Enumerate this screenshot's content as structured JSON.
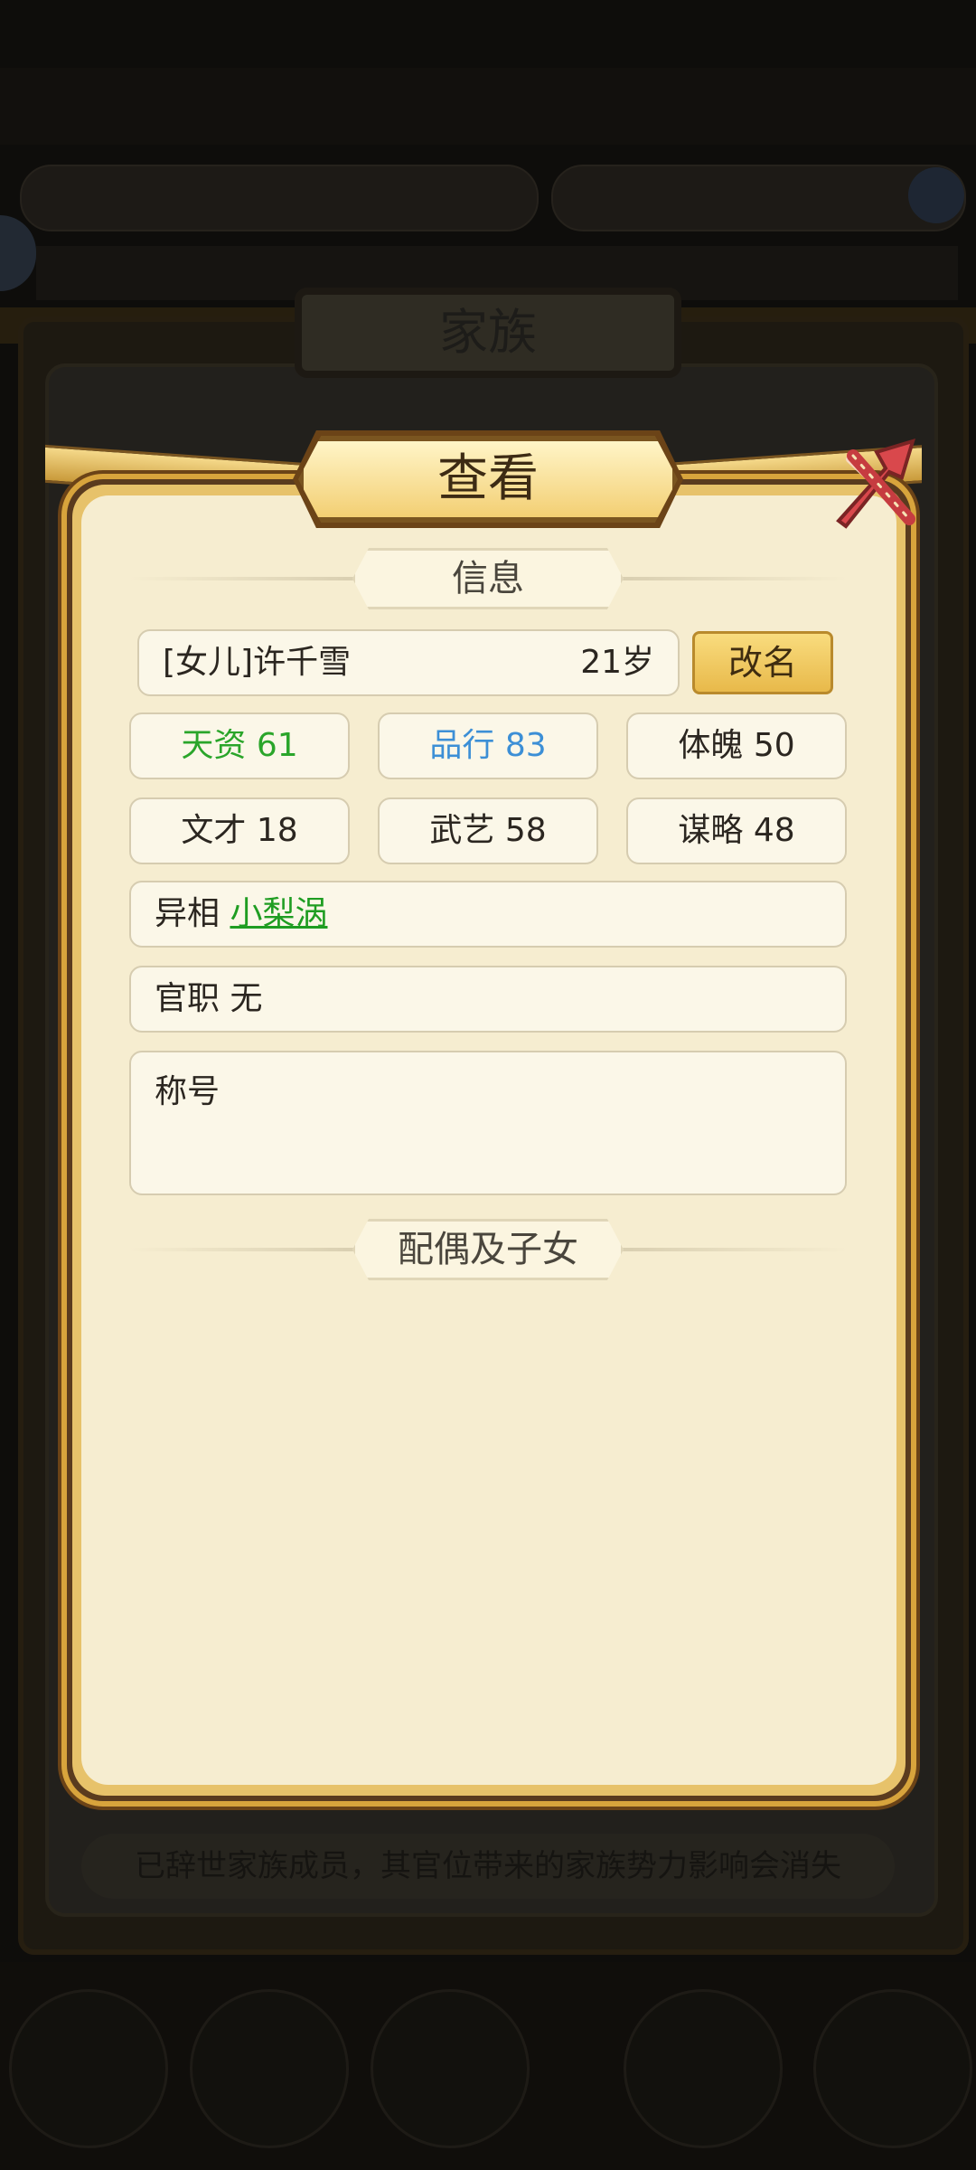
{
  "background": {
    "family_title": "家族",
    "notice": "已辞世家族成员，其官位带来的家族势力影响会消失"
  },
  "dialog": {
    "title": "查看",
    "info_section": "信息",
    "children_section": "配偶及子女",
    "member": {
      "name": "[女儿]许千雪",
      "age": "21岁"
    },
    "rename_label": "改名",
    "stats": [
      {
        "label": "天资",
        "value": "61",
        "color": "#2aa52a"
      },
      {
        "label": "品行",
        "value": "83",
        "color": "#3c8fd6"
      },
      {
        "label": "体魄",
        "value": "50",
        "color": "#2b2620"
      },
      {
        "label": "文才",
        "value": "18",
        "color": "#2b2620"
      },
      {
        "label": "武艺",
        "value": "58",
        "color": "#2b2620"
      },
      {
        "label": "谋略",
        "value": "48",
        "color": "#2b2620"
      }
    ],
    "trait": {
      "label": "异相",
      "value": "小梨涡"
    },
    "office": {
      "label": "官职",
      "value": "无"
    },
    "honorific": {
      "label": "称号"
    }
  }
}
